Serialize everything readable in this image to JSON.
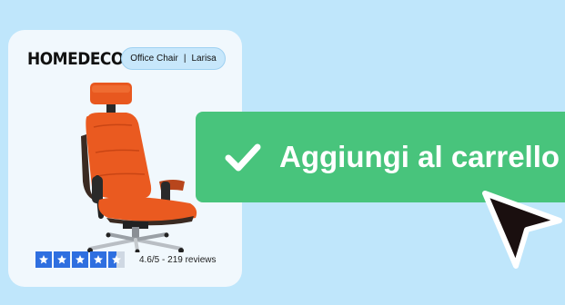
{
  "card": {
    "brand": "HOMEDECO",
    "category": "Office Chair",
    "separator": "|",
    "model": "Larisa"
  },
  "rating": {
    "text": "4.6/5 - 219 reviews",
    "score": 4.6,
    "max": 5
  },
  "cart_button": {
    "label": "Aggiungi al carrello"
  },
  "colors": {
    "background": "#bfe6fb",
    "card": "#f1f8fd",
    "button": "#48c47c",
    "star": "#2f6fe0",
    "chair": "#ea5a20"
  },
  "icons": {
    "check": "checkmark-icon",
    "cursor": "mouse-pointer-icon",
    "star": "star-icon"
  }
}
